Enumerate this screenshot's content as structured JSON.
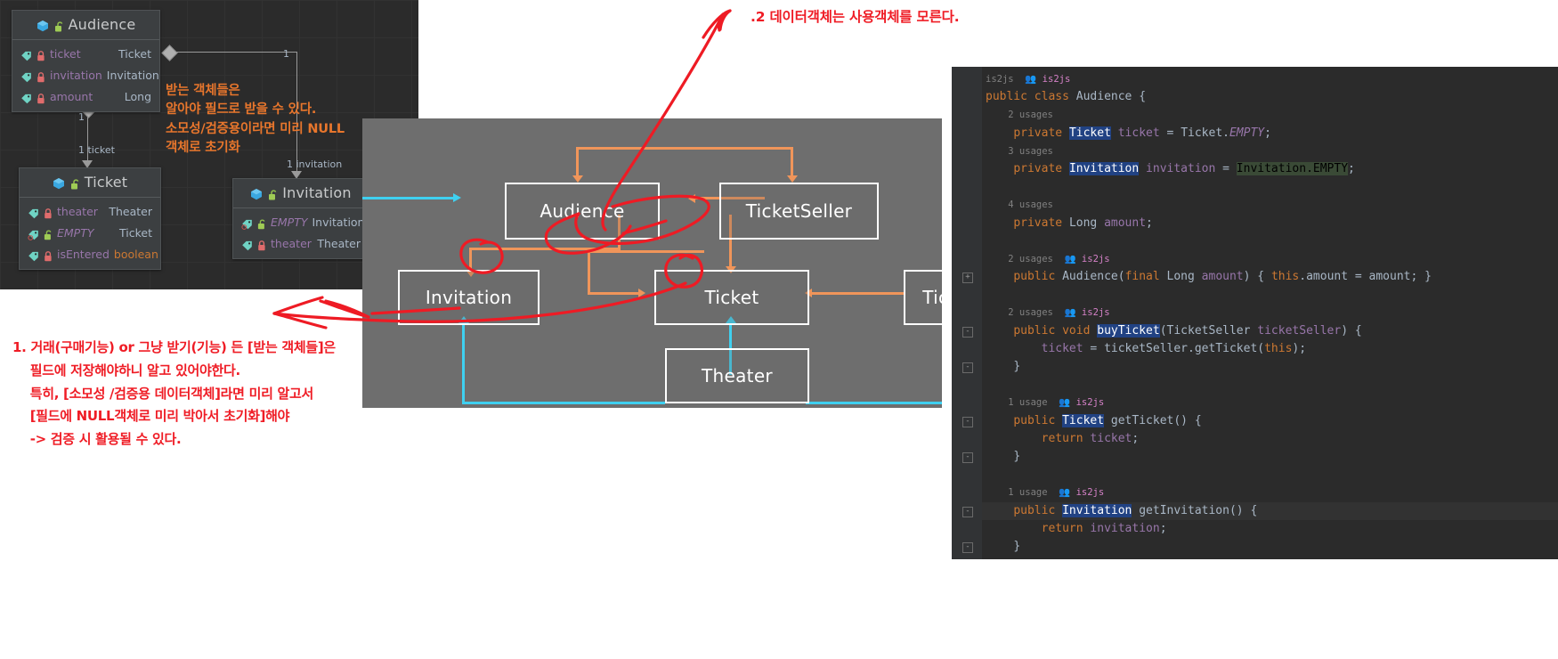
{
  "uml": {
    "classes": [
      {
        "id": "audience",
        "title": "Audience",
        "rows": [
          {
            "name": "ticket",
            "type": "Ticket",
            "lock": "red",
            "italic": false
          },
          {
            "name": "invitation",
            "type": "Invitation",
            "lock": "red",
            "italic": false
          },
          {
            "name": "amount",
            "type": "Long",
            "lock": "red",
            "italic": false
          }
        ]
      },
      {
        "id": "ticket",
        "title": "Ticket",
        "rows": [
          {
            "name": "theater",
            "type": "Theater",
            "lock": "red",
            "italic": false
          },
          {
            "name": "EMPTY",
            "type": "Ticket",
            "lock": "green",
            "italic": true
          },
          {
            "name": "isEntered",
            "type": "boolean",
            "lock": "red",
            "italic": false,
            "typeKeyword": true
          }
        ]
      },
      {
        "id": "invitation",
        "title": "Invitation",
        "rows": [
          {
            "name": "EMPTY",
            "type": "Invitation",
            "lock": "green",
            "italic": true
          },
          {
            "name": "theater",
            "type": "Theater",
            "lock": "red",
            "italic": false
          }
        ]
      }
    ],
    "edge_labels": {
      "audience_mult": "1",
      "ticket_mult": "1",
      "ticket_role": "1 ticket",
      "invitation_mult": "1",
      "invitation_role": "1 invitation"
    }
  },
  "orange_note": "받는 객체들은\n알아야 필드로 받을 수 있다.\n소모성/검증용이라면 미리 NULL\n객체로 초기화",
  "red_top_note": ".2 데이터객체는 사용객체를 모른다.",
  "red_bottom_note": "1. 거래(구매기능) or 그냥 받기(기능) 든 [받는 객체들]은\n    필드에 저장해야하니 알고 있어야한다.\n    특히, [소모성 /검증용 데이터객체]라면 미리 알고서\n    [필드에 NULL객체로 미리 박아서 초기화]해야\n    -> 검증 시 활용될 수 있다.",
  "video_diagram": {
    "boxes": [
      {
        "id": "audience",
        "label": "Audience"
      },
      {
        "id": "ticketseller",
        "label": "TicketSeller"
      },
      {
        "id": "invitation",
        "label": "Invitation"
      },
      {
        "id": "ticket",
        "label": "Ticket"
      },
      {
        "id": "ticketoffice",
        "label": "TicketOffice"
      },
      {
        "id": "theater",
        "label": "Theater"
      }
    ],
    "colors": {
      "dependency": "#f0955a",
      "association": "#3fd0f0",
      "box_border": "#ffffff"
    }
  },
  "ide": {
    "author": "is2js",
    "lines": [
      {
        "kind": "hint",
        "text": "is2js",
        "author": true
      },
      {
        "kind": "code",
        "tokens": [
          {
            "t": "public ",
            "c": "kw"
          },
          {
            "t": "class ",
            "c": "kw"
          },
          {
            "t": "Audience ",
            "c": "cls"
          },
          {
            "t": "{",
            "c": "brace"
          }
        ]
      },
      {
        "kind": "hint",
        "text": "    2 usages"
      },
      {
        "kind": "code",
        "indent": 1,
        "tokens": [
          {
            "t": "private ",
            "c": "kw"
          },
          {
            "t": "Ticket",
            "c": "sel"
          },
          {
            "t": " ticket ",
            "c": "fld"
          },
          {
            "t": "= ",
            "c": "st"
          },
          {
            "t": "Ticket.",
            "c": "st"
          },
          {
            "t": "EMPTY",
            "c": "em"
          },
          {
            "t": ";",
            "c": "st"
          }
        ]
      },
      {
        "kind": "hint",
        "text": "    3 usages"
      },
      {
        "kind": "code",
        "indent": 1,
        "tokens": [
          {
            "t": "private ",
            "c": "kw"
          },
          {
            "t": "Invitation",
            "c": "sel"
          },
          {
            "t": " invitation ",
            "c": "fld"
          },
          {
            "t": "= ",
            "c": "st"
          },
          {
            "t": "Invitation.",
            "c": "selg"
          },
          {
            "t": "EMPTY",
            "c": "emg"
          },
          {
            "t": ";",
            "c": "st"
          }
        ]
      },
      {
        "kind": "blank"
      },
      {
        "kind": "hint",
        "text": "    4 usages"
      },
      {
        "kind": "code",
        "indent": 1,
        "tokens": [
          {
            "t": "private ",
            "c": "kw"
          },
          {
            "t": "Long ",
            "c": "cls"
          },
          {
            "t": "amount",
            "c": "fld"
          },
          {
            "t": ";",
            "c": "st"
          }
        ]
      },
      {
        "kind": "blank"
      },
      {
        "kind": "hint",
        "text": "    2 usages",
        "author": true
      },
      {
        "kind": "code",
        "indent": 1,
        "fold": "+",
        "tokens": [
          {
            "t": "public ",
            "c": "kw"
          },
          {
            "t": "Audience",
            "c": "cls"
          },
          {
            "t": "(",
            "c": "st"
          },
          {
            "t": "final ",
            "c": "kw"
          },
          {
            "t": "Long ",
            "c": "cls"
          },
          {
            "t": "amount",
            "c": "fld"
          },
          {
            "t": ")",
            "c": "st"
          },
          {
            "t": " { ",
            "c": "foldbg"
          },
          {
            "t": "this",
            "c": "kw"
          },
          {
            "t": ".amount = amount; }",
            "c": "st"
          }
        ]
      },
      {
        "kind": "blank"
      },
      {
        "kind": "hint",
        "text": "    2 usages",
        "author": true
      },
      {
        "kind": "code",
        "indent": 1,
        "fold": "-",
        "tokens": [
          {
            "t": "public ",
            "c": "kw"
          },
          {
            "t": "void ",
            "c": "kw"
          },
          {
            "t": "buyTicket",
            "c": "sel"
          },
          {
            "t": "(",
            "c": "st"
          },
          {
            "t": "TicketSeller ",
            "c": "cls"
          },
          {
            "t": "ticketSeller",
            "c": "fld"
          },
          {
            "t": ") ",
            "c": "st"
          },
          {
            "t": "{",
            "c": "brace"
          }
        ]
      },
      {
        "kind": "code",
        "indent": 2,
        "tokens": [
          {
            "t": "ticket ",
            "c": "fld"
          },
          {
            "t": "= ",
            "c": "st"
          },
          {
            "t": "ticketSeller.getTicket(",
            "c": "st"
          },
          {
            "t": "this",
            "c": "kw"
          },
          {
            "t": ");",
            "c": "st"
          }
        ]
      },
      {
        "kind": "code",
        "indent": 1,
        "fold": "-",
        "tokens": [
          {
            "t": "}",
            "c": "brace"
          }
        ]
      },
      {
        "kind": "blank"
      },
      {
        "kind": "hint",
        "text": "    1 usage",
        "author": true
      },
      {
        "kind": "code",
        "indent": 1,
        "fold": "-",
        "tokens": [
          {
            "t": "public ",
            "c": "kw"
          },
          {
            "t": "Ticket",
            "c": "sel"
          },
          {
            "t": " getTicket",
            "c": "cls"
          },
          {
            "t": "() ",
            "c": "st"
          },
          {
            "t": "{",
            "c": "brace"
          }
        ]
      },
      {
        "kind": "code",
        "indent": 2,
        "tokens": [
          {
            "t": "return ",
            "c": "kw"
          },
          {
            "t": "ticket",
            "c": "fld"
          },
          {
            "t": ";",
            "c": "st"
          }
        ]
      },
      {
        "kind": "code",
        "indent": 1,
        "fold": "-",
        "tokens": [
          {
            "t": "}",
            "c": "brace"
          }
        ]
      },
      {
        "kind": "blank"
      },
      {
        "kind": "hint",
        "text": "    1 usage",
        "author": true
      },
      {
        "kind": "code",
        "indent": 1,
        "fold": "-",
        "hlrow": true,
        "tokens": [
          {
            "t": "public ",
            "c": "kw"
          },
          {
            "t": "Invitation",
            "c": "sel"
          },
          {
            "t": " getInvitation",
            "c": "cls"
          },
          {
            "t": "() ",
            "c": "st"
          },
          {
            "t": "{",
            "c": "brace"
          }
        ]
      },
      {
        "kind": "code",
        "indent": 2,
        "tokens": [
          {
            "t": "return ",
            "c": "kw"
          },
          {
            "t": "invitation",
            "c": "fld"
          },
          {
            "t": ";",
            "c": "st"
          }
        ]
      },
      {
        "kind": "code",
        "indent": 1,
        "fold": "-",
        "tokens": [
          {
            "t": "}",
            "c": "brace"
          }
        ]
      }
    ]
  },
  "colors": {
    "ink_red": "#ef1c25",
    "orange": "#e8762c",
    "ide_bg": "#2b2b2b",
    "uml_bg": "#2b2b2b",
    "selection_blue": "#214283"
  }
}
